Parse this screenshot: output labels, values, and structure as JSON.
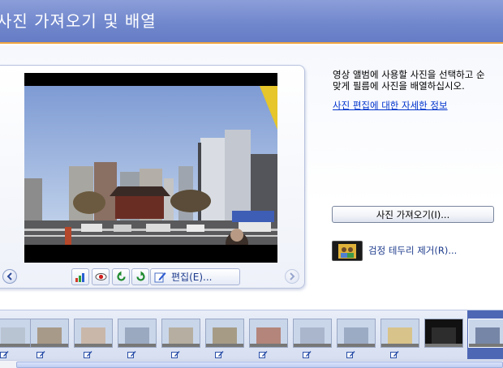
{
  "header": {
    "title": "사진 가져오기 및 배열"
  },
  "preview": {
    "edit_label": "편집(E)...",
    "tools": [
      "color-adjust-icon",
      "red-eye-icon",
      "rotate-left-icon",
      "rotate-right-icon"
    ]
  },
  "side": {
    "description_line1": "영상 앨범에 사용할 사진을 선택하고 순",
    "description_line2": "맞게 필름에 사진을 배열하십시오.",
    "info_link": "사진 편집에 대한 자세한 정보",
    "import_button": "사진 가져오기(I)...",
    "remove_border_link": "검정 테두리 제거(R)..."
  },
  "filmstrip": {
    "thumbnails": [
      {
        "name": "thumb-1",
        "tone": "#b9c4d2"
      },
      {
        "name": "thumb-2",
        "tone": "#a89a88"
      },
      {
        "name": "thumb-3",
        "tone": "#c9b7aa"
      },
      {
        "name": "thumb-4",
        "tone": "#9aa9c0"
      },
      {
        "name": "thumb-5",
        "tone": "#b6aea0"
      },
      {
        "name": "thumb-6",
        "tone": "#a69c86"
      },
      {
        "name": "thumb-7",
        "tone": "#b4857a"
      },
      {
        "name": "thumb-8",
        "tone": "#aab6cc"
      },
      {
        "name": "thumb-9",
        "tone": "#9cabc4"
      },
      {
        "name": "thumb-10",
        "tone": "#d8c38a"
      },
      {
        "name": "thumb-11",
        "tone": "#2d2d2d"
      },
      {
        "name": "thumb-12",
        "tone": "#7686a6"
      }
    ],
    "selected_index": 11
  },
  "colors": {
    "header_bg": "#6f86cc",
    "header_accent": "#f0a640",
    "link": "#0033cc",
    "selection": "#4e67b5"
  }
}
